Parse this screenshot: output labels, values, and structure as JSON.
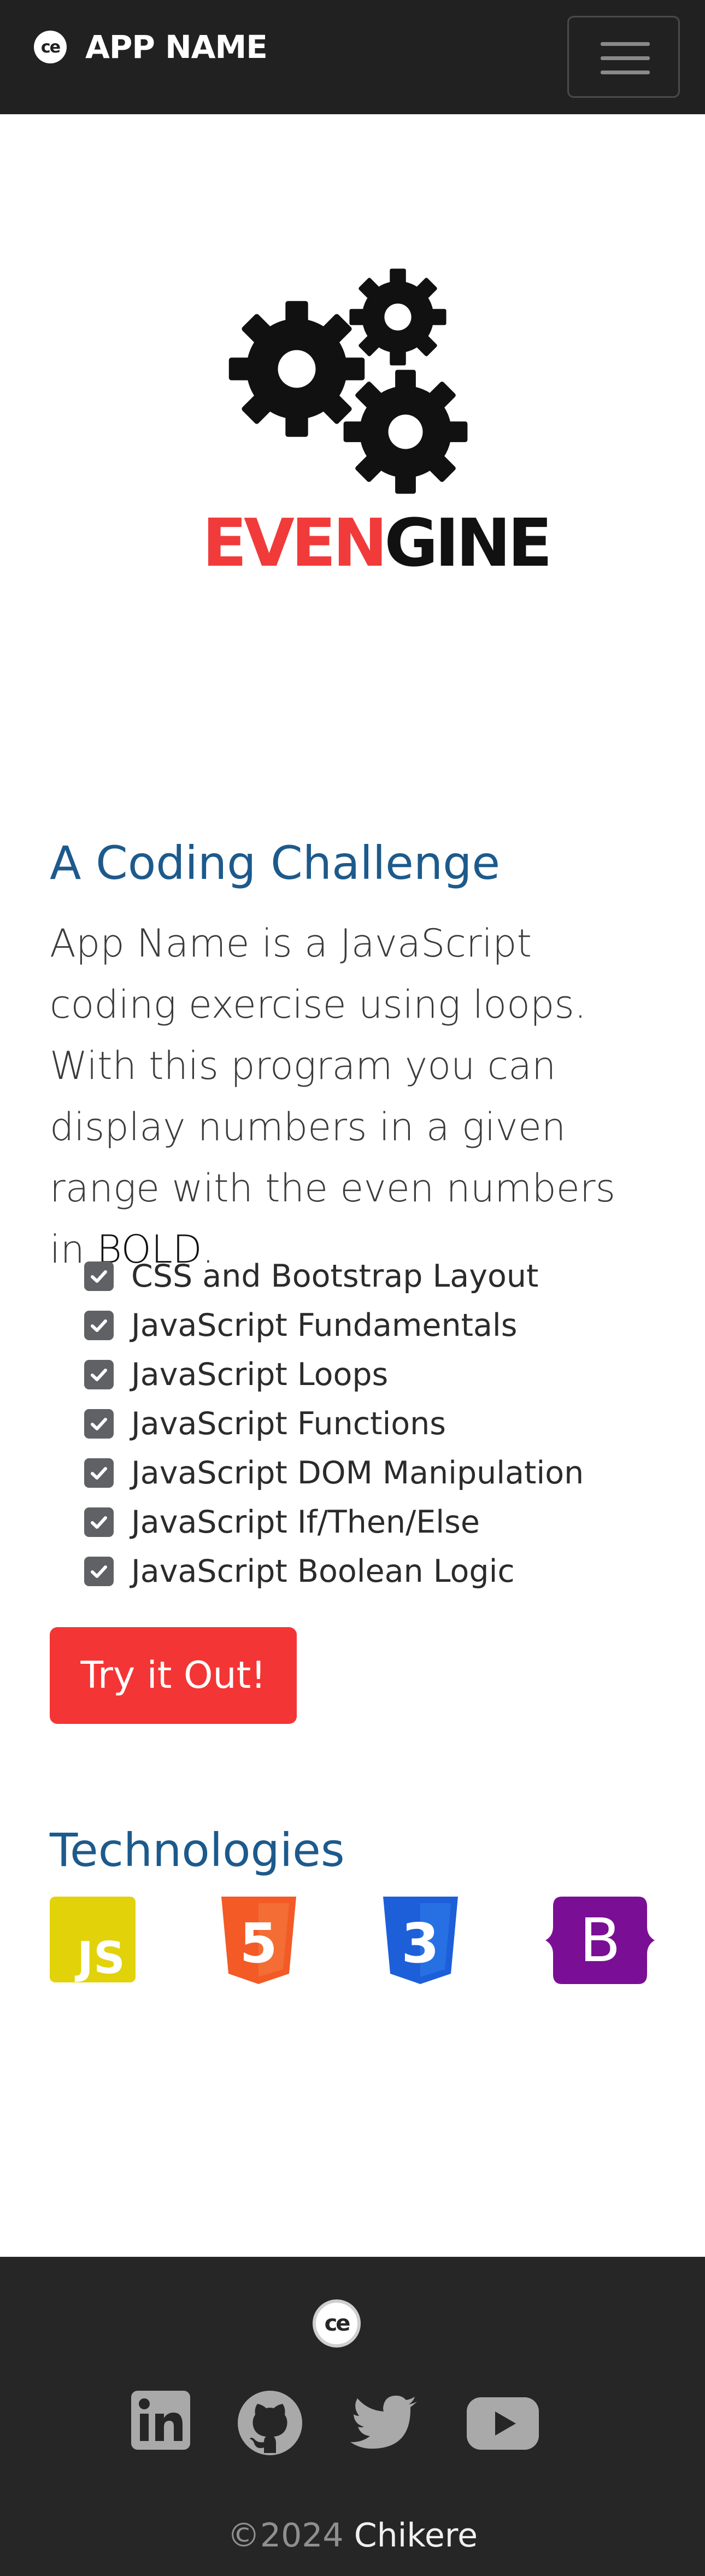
{
  "navbar": {
    "brand_logo_text": "ce",
    "brand_name": "APP NAME"
  },
  "hero": {
    "wordmark_red": "EVEN",
    "wordmark_dark": "GINE"
  },
  "challenge": {
    "title": "A Coding Challenge",
    "description": "App Name is a JavaScript coding exercise using loops. With this program you can display numbers in a given range with the even numbers in ",
    "description_bold": "BOLD",
    "description_end": ".",
    "items": [
      "CSS and Bootstrap Layout",
      "JavaScript Fundamentals",
      "JavaScript Loops",
      "JavaScript Functions",
      "JavaScript DOM Manipulation",
      "JavaScript If/Then/Else",
      "JavaScript Boolean Logic"
    ],
    "cta_label": "Try it Out!"
  },
  "technologies": {
    "title": "Technologies",
    "icons": [
      "javascript-icon",
      "html5-icon",
      "css3-icon",
      "bootstrap-icon"
    ],
    "js_label": "JS",
    "html_label": "5",
    "css_label": "3",
    "bootstrap_label": "B"
  },
  "footer": {
    "logo_text": "ce",
    "social": [
      "linkedin-icon",
      "github-icon",
      "twitter-icon",
      "youtube-icon"
    ],
    "copyright_year": "©2024",
    "copyright_owner": "Chikere"
  },
  "colors": {
    "nav_bg": "#212121",
    "heading_blue": "#1d5a8c",
    "cta_red": "#f43535",
    "js_yellow": "#e2d20a",
    "html_orange": "#f35a26",
    "css_blue": "#1d5fd9",
    "bootstrap_purple": "#7a0f96",
    "footer_bg": "#262626"
  }
}
